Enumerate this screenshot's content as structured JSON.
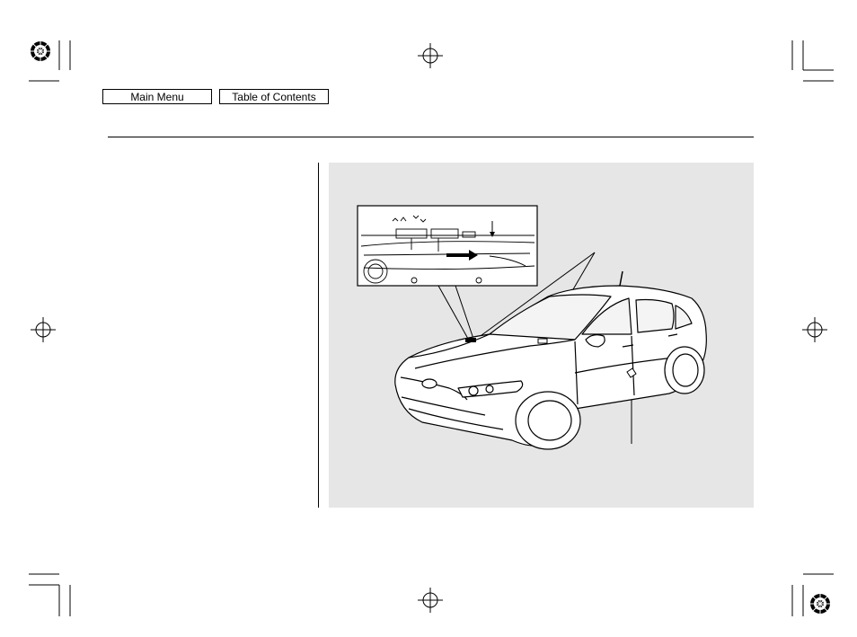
{
  "nav": {
    "main_menu_label": "Main Menu",
    "table_of_contents_label": "Table of Contents"
  },
  "illustration": {
    "subject": "sedan-vin-label-locations",
    "background_color": "#e6e6e6"
  }
}
